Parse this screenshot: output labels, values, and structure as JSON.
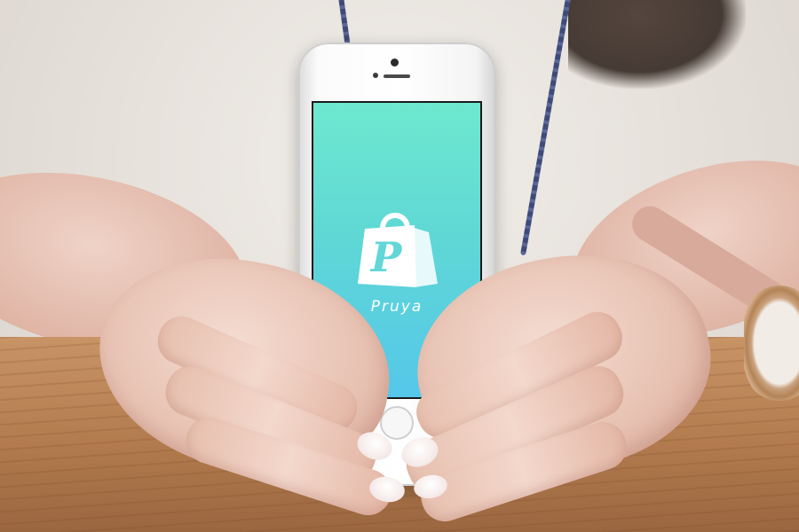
{
  "app": {
    "name": "Pruya",
    "logo_letter": "P",
    "icon": "shopping-bag-icon"
  },
  "colors": {
    "screen_top": "#6ee9cf",
    "screen_bottom": "#55c7ea",
    "logo": "#ffffff"
  }
}
